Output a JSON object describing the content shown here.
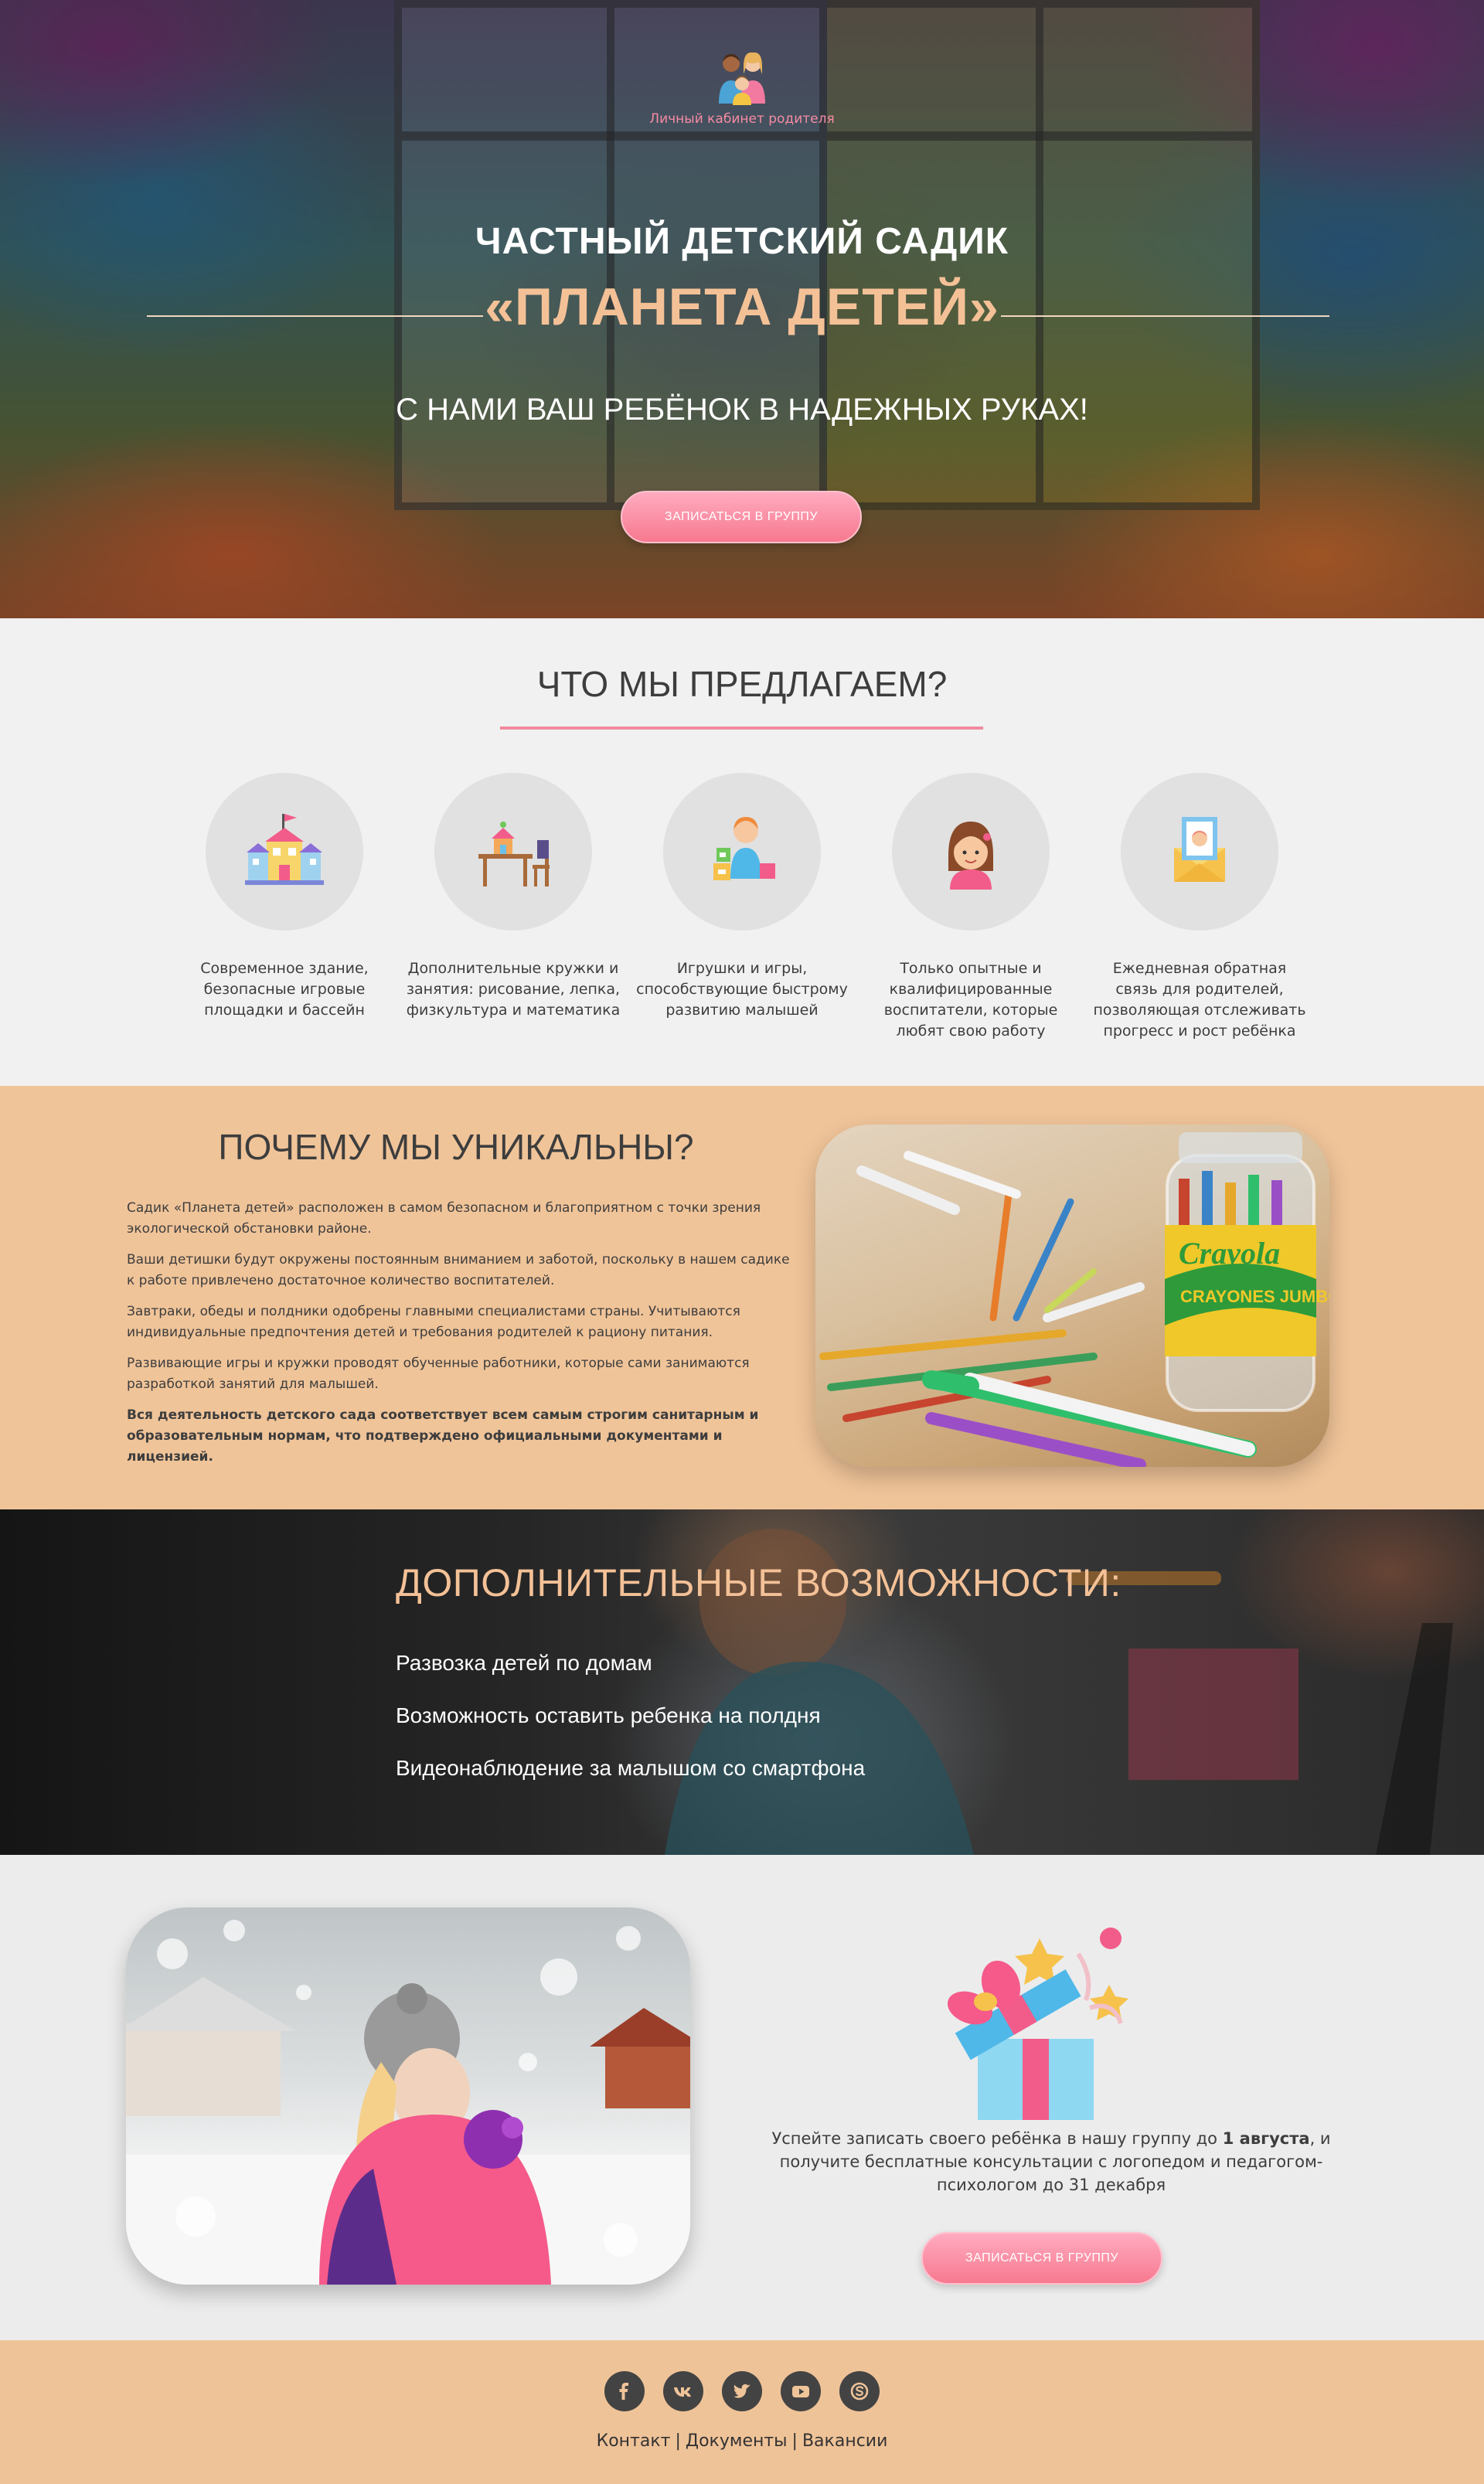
{
  "header": {
    "parent_link": "Личный кабинет родителя"
  },
  "hero": {
    "title": "ЧАСТНЫЙ ДЕТСКИЙ САДИК",
    "name": "«ПЛАНЕТА ДЕТЕЙ»",
    "tagline": "С НАМИ ВАШ РЕБЁНОК В НАДЕЖНЫХ РУКАХ!",
    "cta": "ЗАПИСАТЬСЯ В ГРУППУ"
  },
  "offer": {
    "title": "ЧТО МЫ ПРЕДЛАГАЕМ?",
    "items": [
      {
        "icon": "school-building-icon",
        "text": "Современное здание, безопасные игровые площадки и бассейн"
      },
      {
        "icon": "desk-toys-icon",
        "text": "Дополнительные кружки и занятия: рисование, лепка, физкультура и математика"
      },
      {
        "icon": "child-blocks-icon",
        "text": "Игрушки и игры, способствующие быстрому развитию малышей"
      },
      {
        "icon": "girl-teacher-icon",
        "text": "Только опытные и квалифицированные воспитатели, которые любят свою работу"
      },
      {
        "icon": "baby-card-icon",
        "text": "Ежедневная обратная связь для родителей, позволяющая отслеживать прогресс и рост ребёнка"
      }
    ]
  },
  "unique": {
    "title": "ПОЧЕМУ МЫ УНИКАЛЬНЫ?",
    "paragraphs": [
      "Садик «Планета детей» расположен в самом безопасном и  благоприятном с точки зрения экологической обстановки районе.",
      "Ваши детишки будут окружены постоянным вниманием и заботой, поскольку в нашем садике к работе привлечено достаточное количество воспитателей.",
      "Завтраки, обеды и полдники одобрены главными специалистами страны. Учитываются индивидуальные предпочтения детей и требования родителей к рациону питания.",
      "Развивающие игры и кружки проводят обученные работники, которые сами занимаются разработкой занятий для малышей."
    ],
    "bold_paragraph": "Вся деятельность детского сада соответствует всем самым строгим санитарным и образовательным нормам, что подтверждено официальными документами и лицензией.",
    "jar_brand": "Crayola",
    "jar_label": "CRAYONES JUMBO"
  },
  "extra": {
    "title": "ДОПОЛНИТЕЛЬНЫЕ ВОЗМОЖНОСТИ:",
    "items": [
      "Развозка детей по домам",
      "Возможность оставить ребенка на полдня",
      "Видеонаблюдение за малышом со смартфона"
    ]
  },
  "promo": {
    "text_before": "Успейте записать своего ребёнка в нашу группу до ",
    "date_bold": "1 августа",
    "text_after": ", и получите бесплатные консультации с логопедом и педагогом-психологом до 31 декабря",
    "cta": "ЗАПИСАТЬСЯ В ГРУППУ"
  },
  "footer": {
    "socials": [
      "facebook-icon",
      "vk-icon",
      "twitter-icon",
      "youtube-icon",
      "skype-icon"
    ],
    "links": [
      "Контакт",
      "Документы",
      "Вакансии"
    ],
    "separator": "|"
  },
  "colors": {
    "accent_pink": "#f7798f",
    "accent_peach": "#f0c499",
    "title_peach": "#f4c197",
    "text_dark": "#3d3d3d"
  }
}
